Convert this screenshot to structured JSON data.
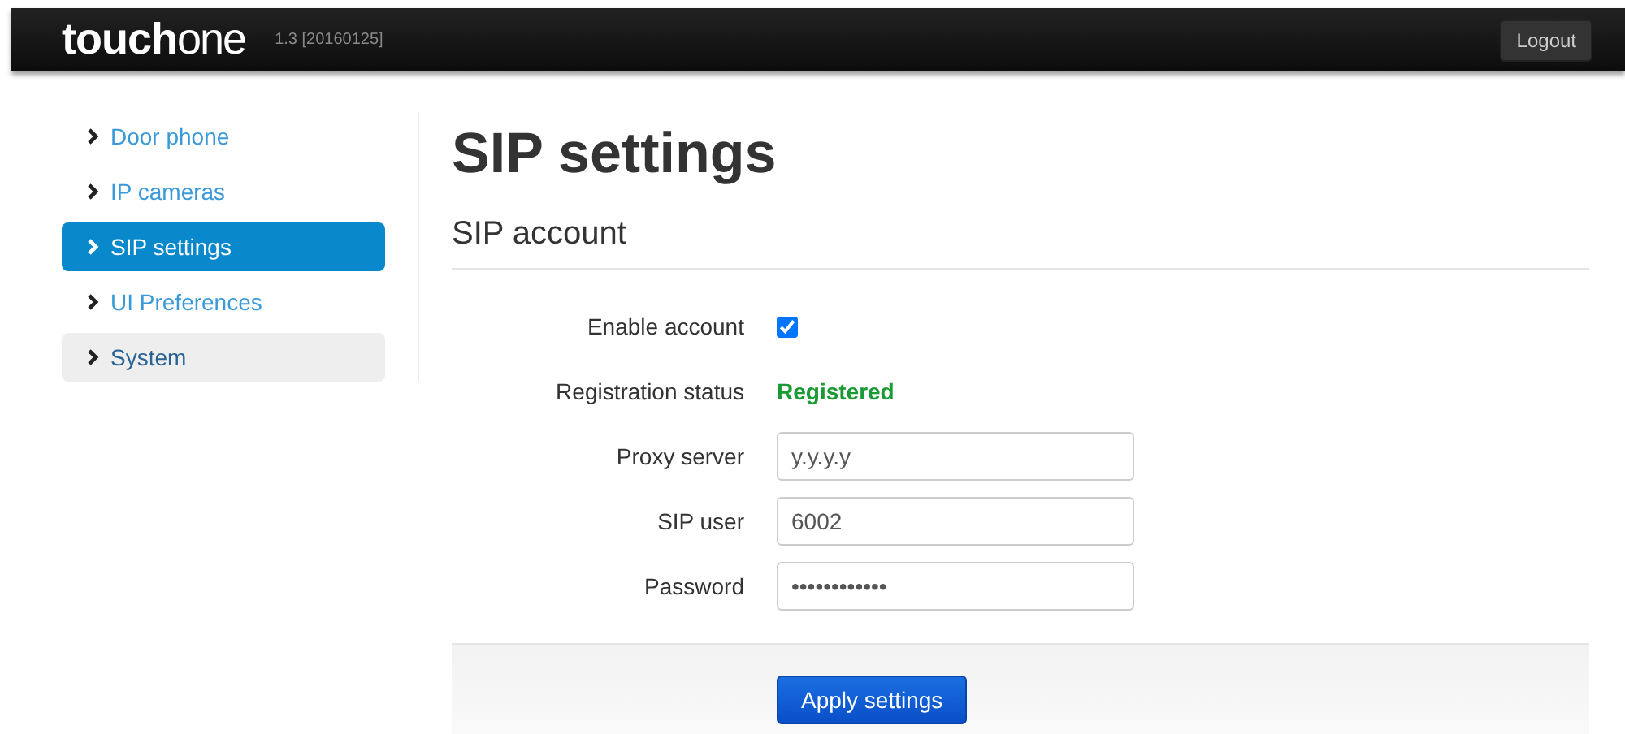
{
  "header": {
    "logo": {
      "bold": "touch",
      "light": "one"
    },
    "version": "1.3 [20160125]",
    "logout": "Logout"
  },
  "sidebar": {
    "items": [
      {
        "label": "Door phone",
        "selected": false,
        "hovered": false
      },
      {
        "label": "IP cameras",
        "selected": false,
        "hovered": false
      },
      {
        "label": "SIP settings",
        "selected": true,
        "hovered": false
      },
      {
        "label": "UI Preferences",
        "selected": false,
        "hovered": false
      },
      {
        "label": "System",
        "selected": false,
        "hovered": true
      }
    ]
  },
  "page": {
    "title": "SIP settings",
    "section": "SIP account",
    "fields": [
      {
        "kind": "checkbox",
        "label": "Enable account",
        "checked": true
      },
      {
        "kind": "status",
        "label": "Registration status",
        "value": "Registered",
        "color": "#1a9a34"
      },
      {
        "kind": "text",
        "label": "Proxy server",
        "value": "y.y.y.y"
      },
      {
        "kind": "text",
        "label": "SIP user",
        "value": "6002"
      },
      {
        "kind": "text",
        "label": "Password",
        "value": "••••••••••••"
      }
    ],
    "apply": "Apply settings"
  }
}
